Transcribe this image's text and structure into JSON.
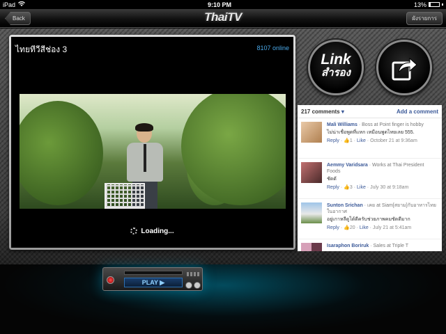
{
  "status_bar": {
    "device": "iPad",
    "time": "9:10 PM",
    "battery": "13%"
  },
  "navbar": {
    "back_label": "Back",
    "logo_text": "ThaiTV",
    "right_button_label": "ผังรายการ"
  },
  "player": {
    "channel_title": "ไทยทีวีสีช่อง 3",
    "online_count": "8107 online",
    "loading_text": "Loading..."
  },
  "actions": {
    "link_line1": "Link",
    "link_line2": "สำรอง",
    "share_icon": "share-icon"
  },
  "comments": {
    "count_label": "217 comments",
    "add_label": "Add a comment",
    "items": [
      {
        "name": "Mali Williams",
        "work": " · Boss at Point finger is hobby",
        "text": "ไม่น่าเชื่อพูดที่แหก เหมือนพูดไทยเลย 555.",
        "reply": "Reply",
        "likes": "1",
        "like": "Like",
        "time": "October 21 at 9:36am"
      },
      {
        "name": "Aemmy Varidsara",
        "work": " · Works at Thai President Foods",
        "text": "ชัดดั",
        "reply": "Reply",
        "likes": "3",
        "like": "Like",
        "time": "July 30 at 9:18am"
      },
      {
        "name": "Sunton Srichan",
        "work": " · เคย at Siam[สยาม]กับอาหารไทยในอากาศ",
        "text": "อยู่เกาหลีดูได้ดีครับช่วยภาพคมชัดดีมาก",
        "reply": "Reply",
        "likes": "20",
        "like": "Like",
        "time": "July 21 at 5:41am"
      },
      {
        "name": "Isaraphon Boriruk",
        "work": " · Sales at Triple T",
        "text": "",
        "reply": "",
        "likes": "",
        "like": "",
        "time": ""
      }
    ]
  },
  "deck": {
    "play_label": "PLAY ▶"
  },
  "colors": {
    "link_blue": "#3b5998",
    "online_blue": "#4aa8e8",
    "deck_glow": "#00c8ff"
  }
}
